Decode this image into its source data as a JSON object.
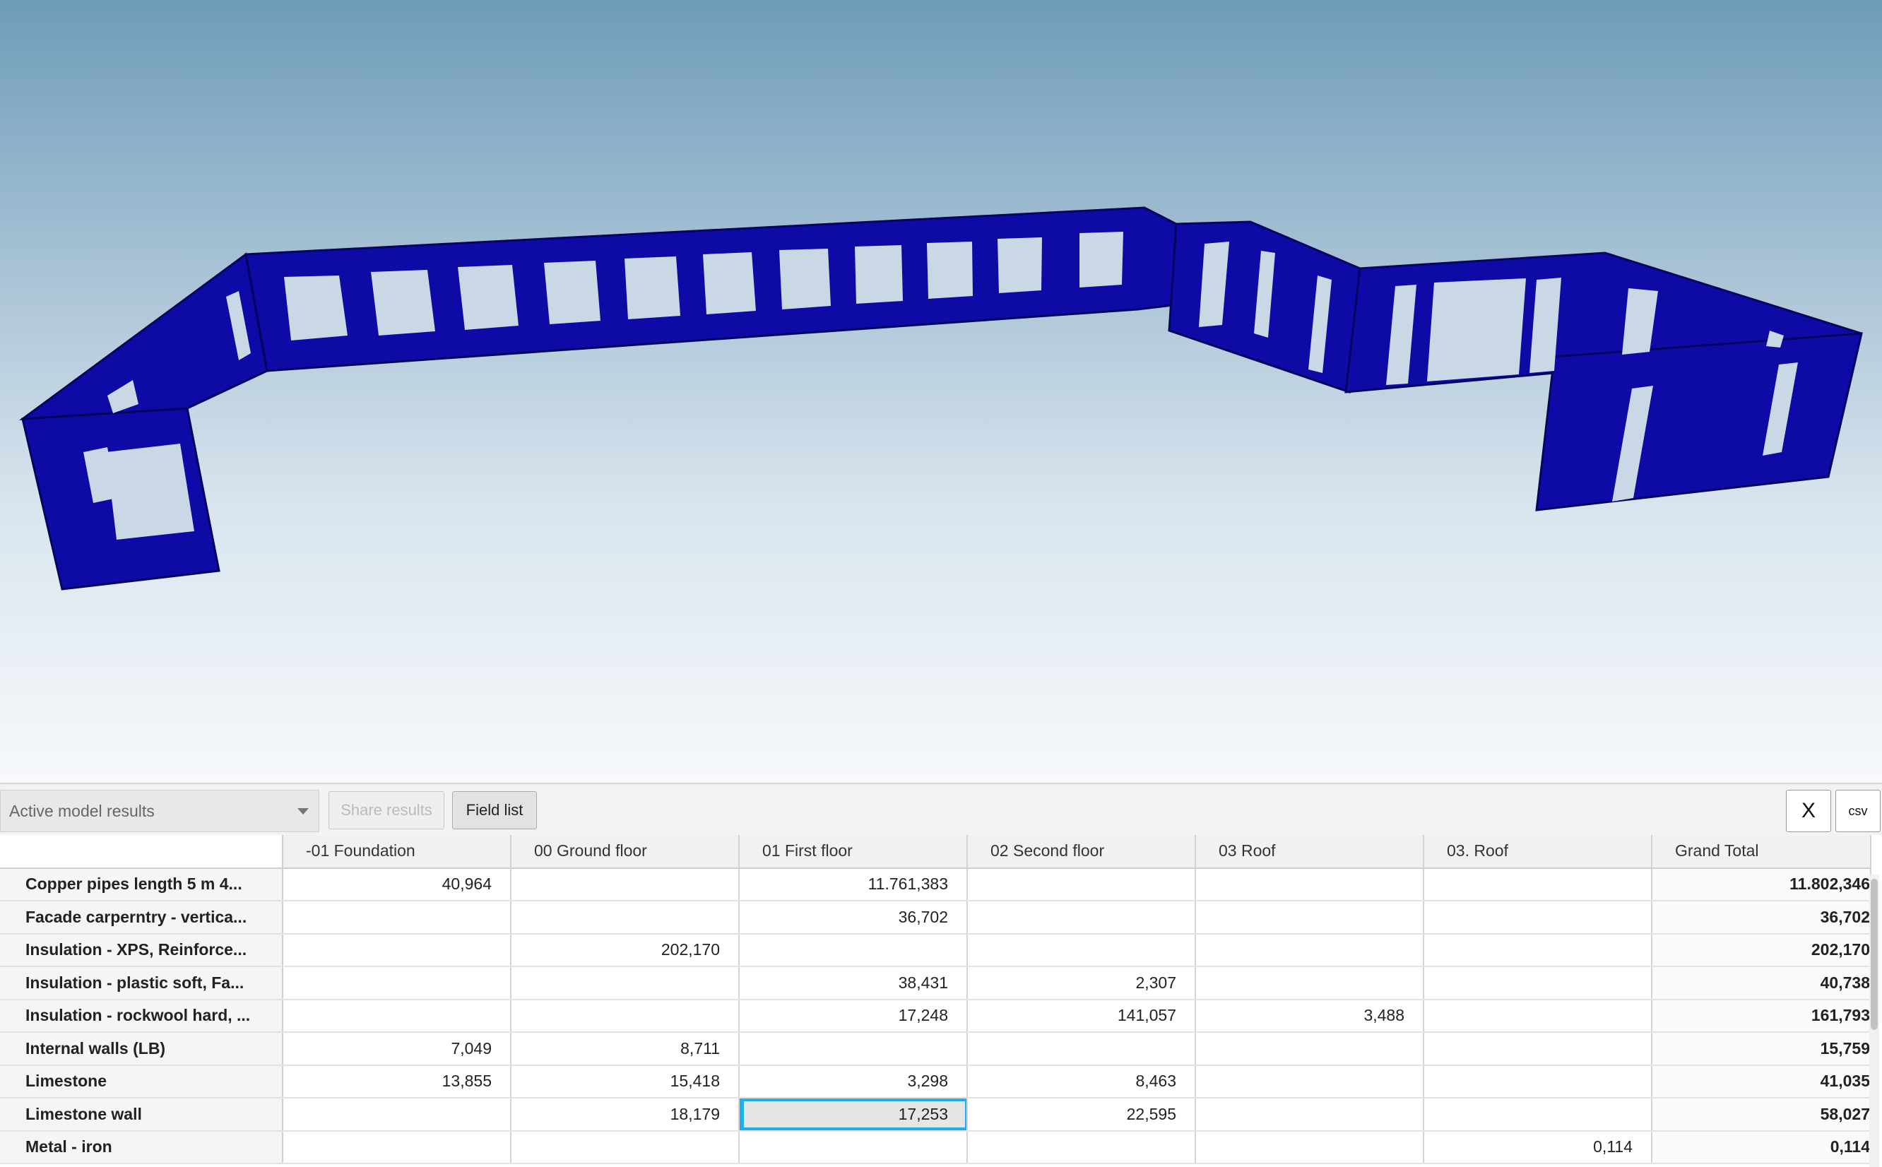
{
  "toolbar": {
    "results_dropdown": "Active model results",
    "share_label": "Share results",
    "field_list_label": "Field list",
    "close_label": "X",
    "csv_label": "csv"
  },
  "table": {
    "columns": [
      "-01 Foundation",
      "00 Ground floor",
      "01 First floor",
      "02 Second floor",
      "03 Roof",
      "03. Roof",
      "Grand Total"
    ],
    "rows": [
      {
        "label": "Copper pipes length 5 m 4...",
        "cells": [
          "40,964",
          "",
          "11.761,383",
          "",
          "",
          "",
          "11.802,346"
        ]
      },
      {
        "label": "Facade carperntry - vertica...",
        "cells": [
          "",
          "",
          "36,702",
          "",
          "",
          "",
          "36,702"
        ]
      },
      {
        "label": "Insulation - XPS, Reinforce...",
        "cells": [
          "",
          "202,170",
          "",
          "",
          "",
          "",
          "202,170"
        ]
      },
      {
        "label": "Insulation - plastic soft, Fa...",
        "cells": [
          "",
          "",
          "38,431",
          "2,307",
          "",
          "",
          "40,738"
        ]
      },
      {
        "label": "Insulation - rockwool hard, ...",
        "cells": [
          "",
          "",
          "17,248",
          "141,057",
          "3,488",
          "",
          "161,793"
        ]
      },
      {
        "label": "Internal walls (LB)",
        "cells": [
          "7,049",
          "8,711",
          "",
          "",
          "",
          "",
          "15,759"
        ]
      },
      {
        "label": "Limestone",
        "cells": [
          "13,855",
          "15,418",
          "3,298",
          "8,463",
          "",
          "",
          "41,035"
        ]
      },
      {
        "label": "Limestone wall",
        "cells": [
          "",
          "18,179",
          "17,253",
          "22,595",
          "",
          "",
          "58,027"
        ]
      },
      {
        "label": "Metal - iron",
        "cells": [
          "",
          "",
          "",
          "",
          "",
          "0,114",
          "0,114"
        ]
      }
    ],
    "selected_cell": {
      "row": 7,
      "col": 2
    }
  },
  "viewport": {
    "wall_color": "#0d0aa6",
    "wall_edge_color": "#06055e"
  }
}
